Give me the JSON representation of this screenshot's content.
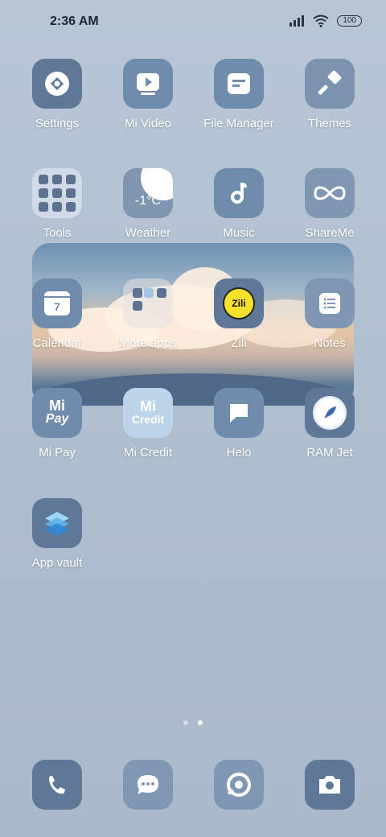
{
  "status_bar": {
    "time": "2:36 AM",
    "battery": "100",
    "signal_icon": "signal-icon",
    "wifi_icon": "wifi-icon"
  },
  "apps": [
    {
      "label": "Settings"
    },
    {
      "label": "Mi Video"
    },
    {
      "label": "File Manager"
    },
    {
      "label": "Themes"
    },
    {
      "label": "Tools"
    },
    {
      "label": "Weather",
      "temp": "-1°C"
    },
    {
      "label": "Music"
    },
    {
      "label": "ShareMe"
    },
    {
      "label": "Calendar",
      "day": "7"
    },
    {
      "label": "More apps"
    },
    {
      "label": "Zili",
      "icon_text": "Zili"
    },
    {
      "label": "Notes"
    },
    {
      "label": "Mi Pay",
      "icon_text": "Pay"
    },
    {
      "label": "Mi Credit",
      "icon_text": "Credit"
    },
    {
      "label": "Helo"
    },
    {
      "label": "RAM Jet"
    },
    {
      "label": "App vault"
    }
  ],
  "dock": [
    "phone-icon",
    "messages-icon",
    "browser-icon",
    "camera-icon"
  ],
  "page_indicator": {
    "pages": 2,
    "current": 2
  },
  "colors": {
    "icon_bg": "#6f8cac",
    "accent_dark": "#5f7898"
  }
}
